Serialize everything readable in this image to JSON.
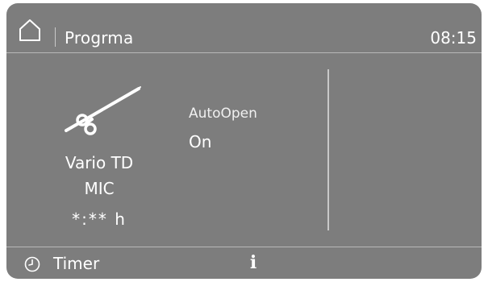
{
  "header": {
    "home_icon": "home-icon",
    "title": "Progrma",
    "time": "08:15"
  },
  "program": {
    "instrument_icon": "instrument-icon",
    "name": "Vario TD",
    "subtitle": "MIC",
    "duration": "*:** h"
  },
  "option": {
    "label": "AutoOpen",
    "value": "On"
  },
  "footer": {
    "timer_icon": "clock-icon",
    "timer_label": "Timer",
    "info_glyph": "i"
  },
  "colors": {
    "background": "#7d7d7d",
    "text": "#ffffff",
    "divider": "#b8b8b8"
  }
}
